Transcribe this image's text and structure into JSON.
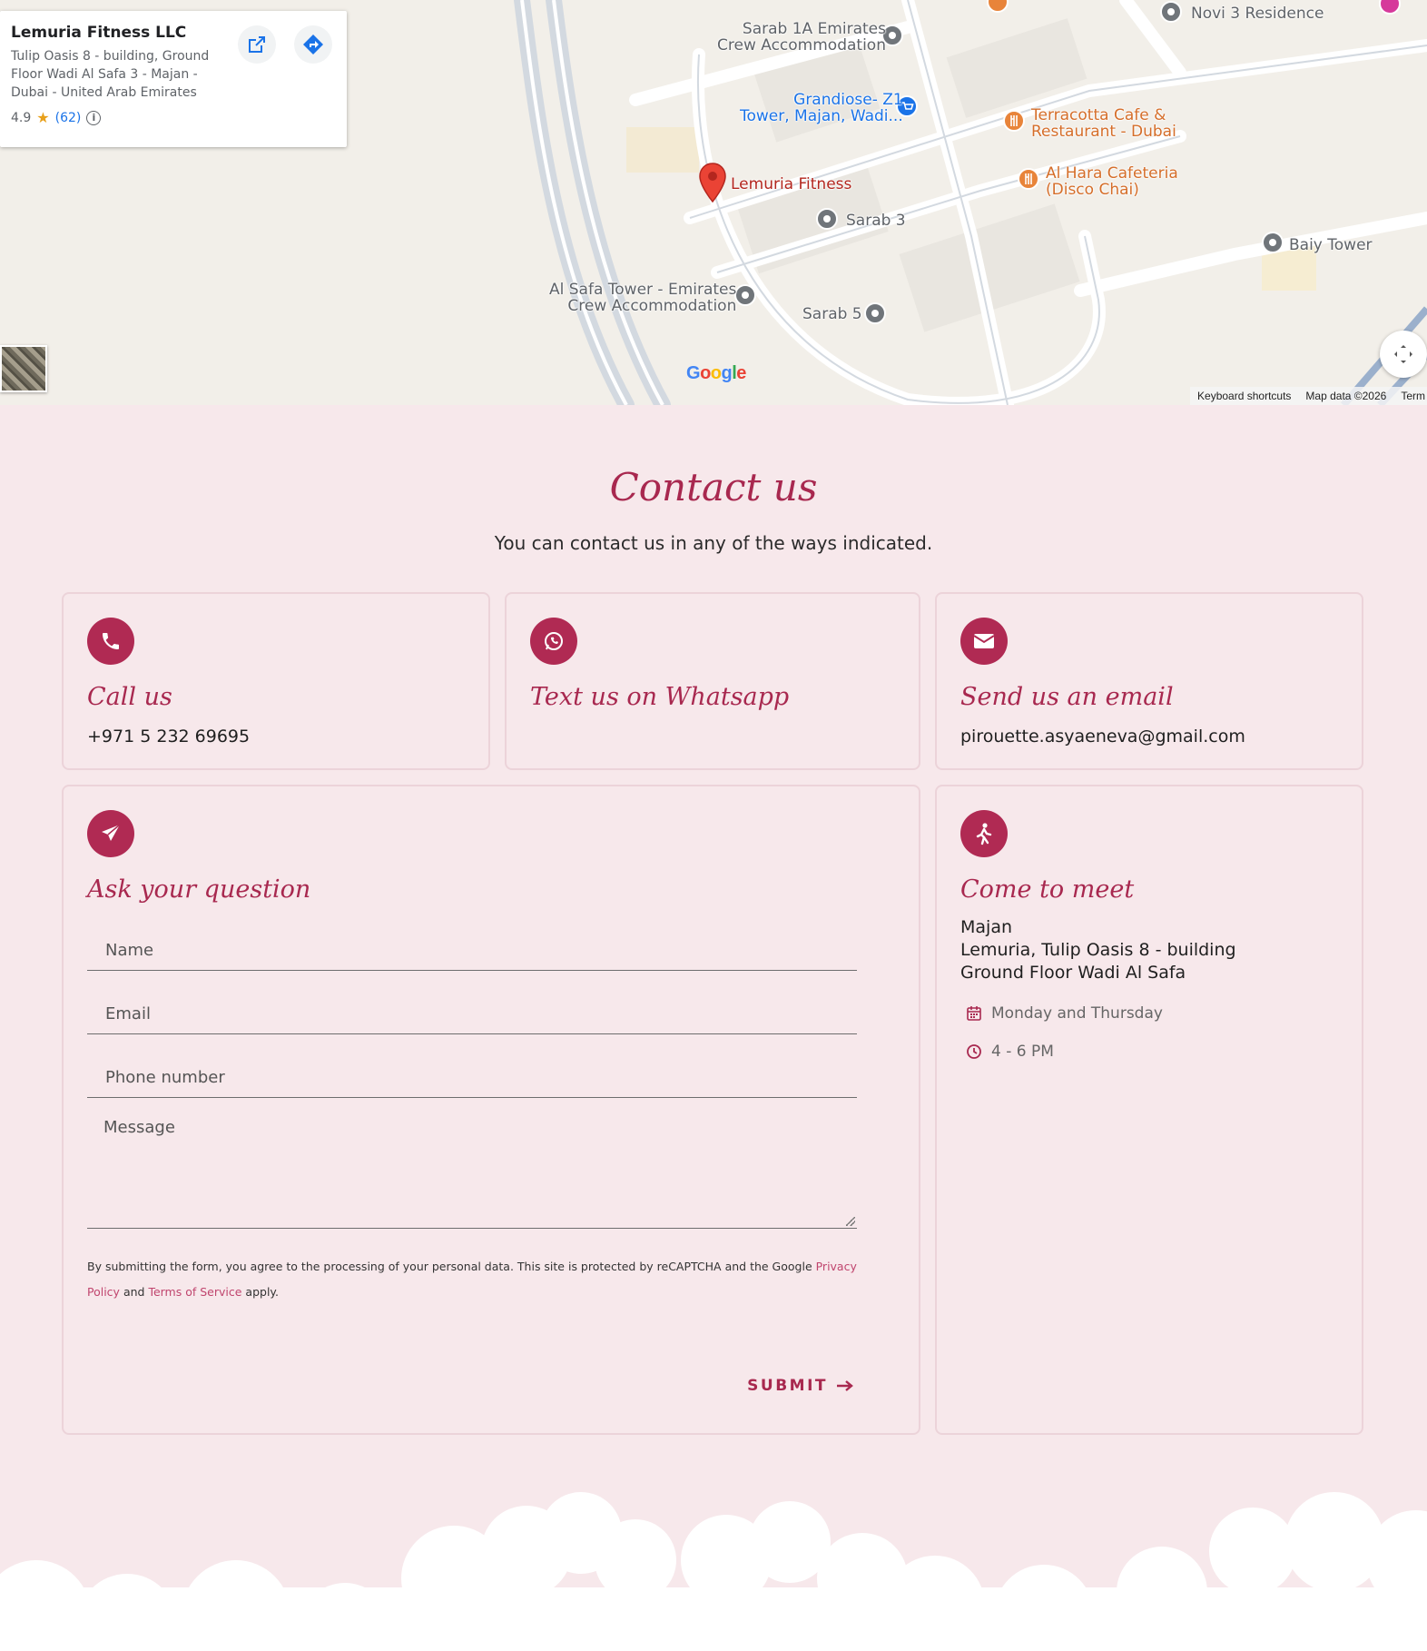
{
  "map": {
    "info_card": {
      "title": "Lemuria Fitness LLC",
      "address": "Tulip Oasis 8 - building, Ground Floor Wadi Al Safa 3 - Majan - Dubai - United Arab Emirates",
      "rating": "4.9",
      "reviews": "(62)"
    },
    "places": {
      "sarab1a": "Sarab 1A Emirates\nCrew Accommodation",
      "novi3": "Novi 3 Residence",
      "grandiose": "Grandiose- Z1\nTower, Majan, Wadi...",
      "terracotta": "Terracotta Cafe &\nRestaurant - Dubai",
      "alhara": "Al Hara Cafeteria\n(Disco Chai)",
      "lemuria": "Lemuria Fitness",
      "sarab3": "Sarab 3",
      "baiy": "Baiy Tower",
      "alsafa": "Al Safa Tower - Emirates\nCrew Accommodation",
      "sarab5": "Sarab 5"
    },
    "google_logo": "Google",
    "attribution": {
      "keyboard": "Keyboard shortcuts",
      "map_data": "Map data ©2026",
      "terms": "Term"
    }
  },
  "contact": {
    "heading": "Contact us",
    "subheading": "You can contact us in any of the ways indicated.",
    "call": {
      "title": "Call us",
      "phone": "+971 5 232 69695",
      "icon": "phone-icon"
    },
    "whatsapp": {
      "title": "Text us on Whatsapp",
      "icon": "whatsapp-icon"
    },
    "email": {
      "title": "Send us an email",
      "address": "pirouette.asyaeneva@gmail.com",
      "icon": "envelope-icon"
    },
    "form": {
      "title": "Ask your question",
      "icon": "paper-plane-icon",
      "name_placeholder": "Name",
      "email_placeholder": "Email",
      "phone_placeholder": "Phone number",
      "message_placeholder": "Message",
      "consent_prefix": "By submitting the form, you agree to the processing of your personal data. This site is protected by reCAPTCHA and the Google ",
      "privacy_link": "Privacy Policy",
      "consent_and": " and ",
      "terms_link": "Terms of Service",
      "consent_suffix": " apply.",
      "submit_label": "SUBMIT"
    },
    "meet": {
      "title": "Come to meet",
      "icon": "walking-icon",
      "address_line1": "Majan",
      "address_line2": "Lemuria, Tulip Oasis 8 - building",
      "address_line3": "Ground Floor Wadi Al Safa",
      "days": "Monday and Thursday",
      "hours": "4 - 6 PM"
    }
  },
  "colors": {
    "accent": "#a8284f",
    "icon_bg": "#b02a53",
    "page_bg": "#f7e8eb",
    "card_border": "#ecd3d9"
  }
}
